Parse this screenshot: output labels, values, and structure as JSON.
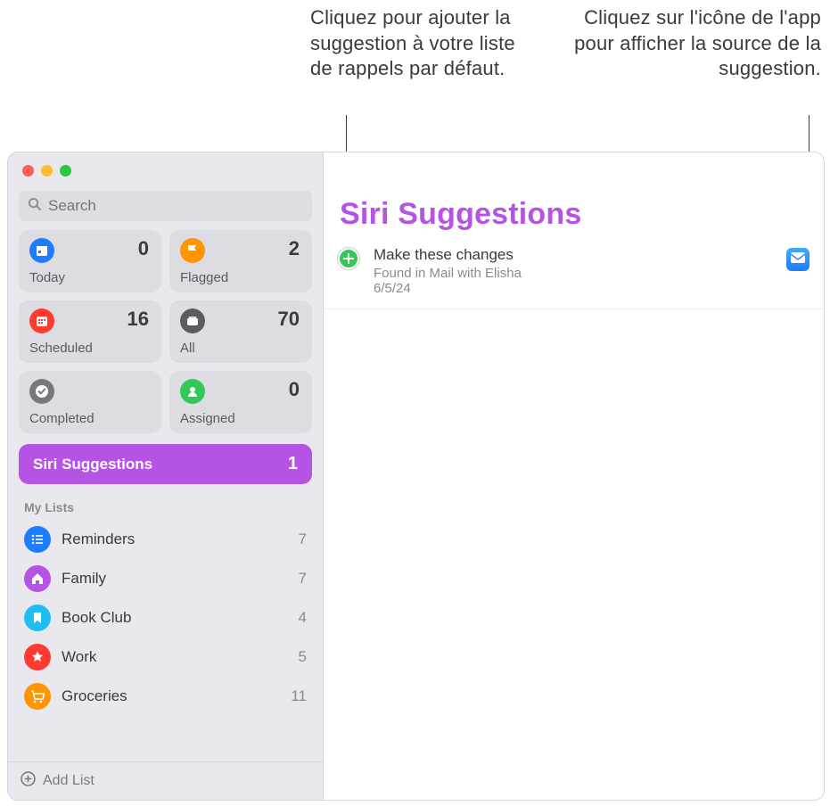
{
  "callouts": {
    "left": "Cliquez pour ajouter la suggestion à votre liste de rappels par défaut.",
    "right": "Cliquez sur l'icône de l'app pour afficher la source de la suggestion."
  },
  "search": {
    "placeholder": "Search"
  },
  "smart": [
    {
      "key": "today",
      "label": "Today",
      "count": 0,
      "color": "#1e7cff"
    },
    {
      "key": "flagged",
      "label": "Flagged",
      "count": 2,
      "color": "#ff9500"
    },
    {
      "key": "scheduled",
      "label": "Scheduled",
      "count": 16,
      "color": "#ff3b30"
    },
    {
      "key": "all",
      "label": "All",
      "count": 70,
      "color": "#5b5b60"
    },
    {
      "key": "completed",
      "label": "Completed",
      "count": "",
      "color": "#77777c"
    },
    {
      "key": "assigned",
      "label": "Assigned",
      "count": 0,
      "color": "#35c759"
    }
  ],
  "siri_row": {
    "label": "Siri Suggestions",
    "count": 1
  },
  "lists_header": "My Lists",
  "lists": [
    {
      "label": "Reminders",
      "count": 7,
      "color": "#1e7cff",
      "icon": "list"
    },
    {
      "label": "Family",
      "count": 7,
      "color": "#b453e4",
      "icon": "house"
    },
    {
      "label": "Book Club",
      "count": 4,
      "color": "#1ebef0",
      "icon": "bookmark"
    },
    {
      "label": "Work",
      "count": 5,
      "color": "#ff3b30",
      "icon": "star"
    },
    {
      "label": "Groceries",
      "count": 11,
      "color": "#ff9500",
      "icon": "cart"
    }
  ],
  "add_list_label": "Add List",
  "main": {
    "title": "Siri Suggestions",
    "suggestion": {
      "title": "Make these changes",
      "subtitle": "Found in Mail with Elisha",
      "date": "6/5/24"
    }
  },
  "icons": {
    "search": "search-icon",
    "add_suggestion": "plus-circle-icon",
    "source_app": "mail-icon",
    "add_list": "plus-circle-outline-icon"
  }
}
